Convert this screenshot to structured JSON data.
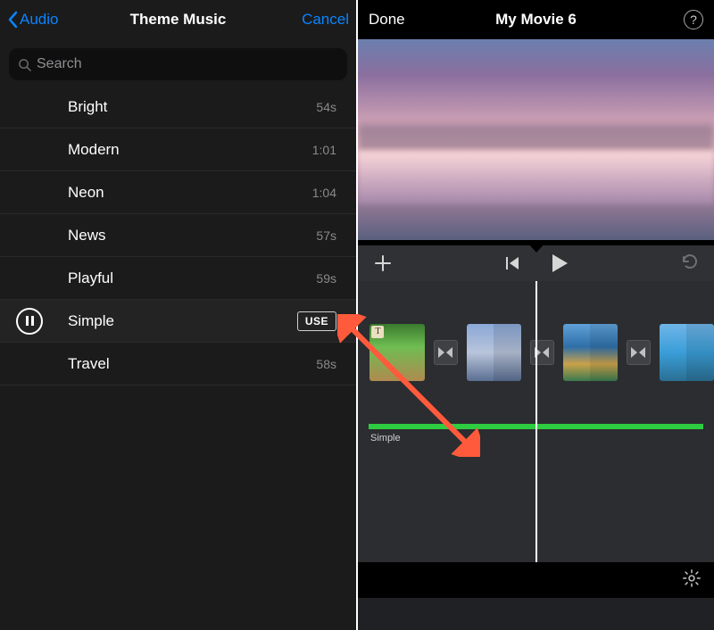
{
  "left": {
    "back_label": "Audio",
    "title": "Theme Music",
    "cancel_label": "Cancel",
    "search_placeholder": "Search",
    "tracks": [
      {
        "label": "Bright",
        "duration": "54s"
      },
      {
        "label": "Modern",
        "duration": "1:01"
      },
      {
        "label": "Neon",
        "duration": "1:04"
      },
      {
        "label": "News",
        "duration": "57s"
      },
      {
        "label": "Playful",
        "duration": "59s"
      },
      {
        "label": "Simple",
        "use_label": "USE",
        "selected": true
      },
      {
        "label": "Travel",
        "duration": "58s"
      }
    ]
  },
  "right": {
    "done_label": "Done",
    "title": "My Movie 6",
    "help_symbol": "?",
    "audio_track_label": "Simple",
    "clip_title_badge": "T"
  }
}
